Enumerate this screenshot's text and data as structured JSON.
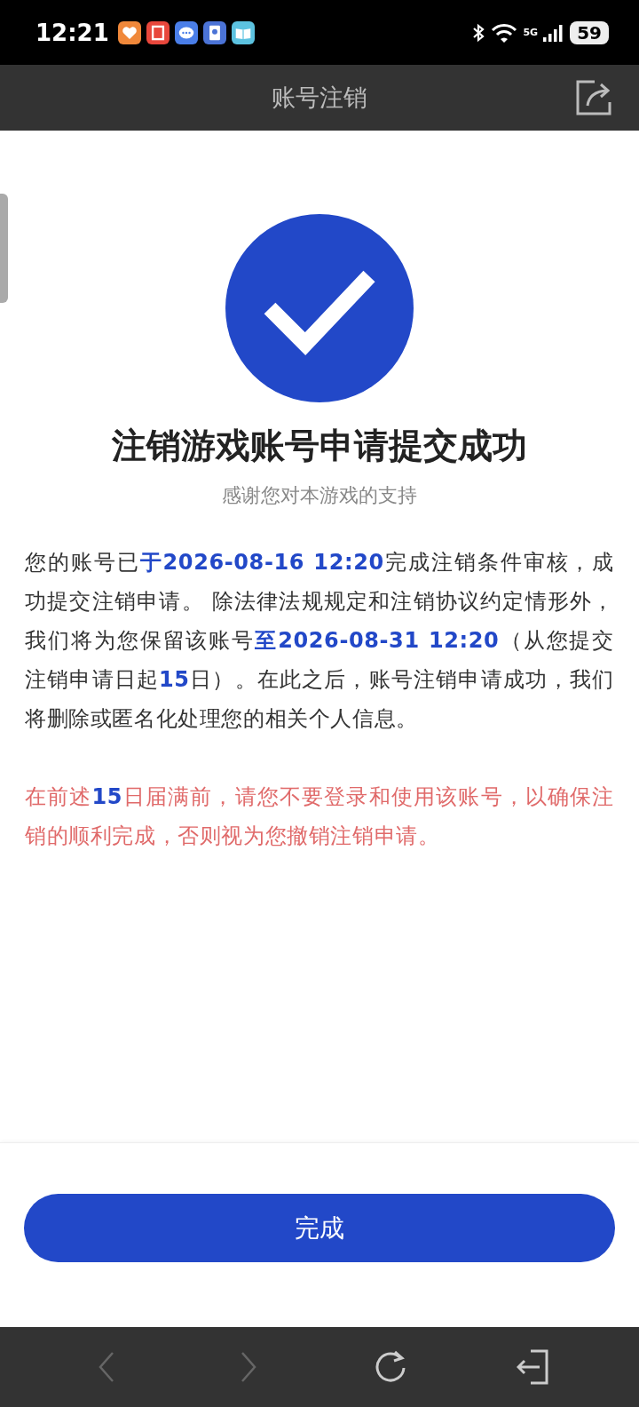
{
  "status_bar": {
    "time": "12:21",
    "network": "5G",
    "battery": "59"
  },
  "header": {
    "title": "账号注销"
  },
  "result": {
    "title": "注销游戏账号申请提交成功",
    "subtitle": "感谢您对本游戏的支持",
    "body": "您的账号已**于2026-08-16 12:20**完成注销条件审核，成功提交注销申请。 除法律法规规定和注销协议约定情形外，我们将为您保留该账号**至2026-08-31 12:20**（从您提交注销申请日起**15**日）。在此之后，账号注销申请成功，我们将删除或匿名化处理您的相关个人信息。",
    "warning": "在前述**15**日届满前，请您不要登录和使用该账号，以确保注销的顺利完成，否则视为您撤销注销申请。"
  },
  "primary_button": {
    "label": "完成"
  },
  "nav_bar": {
    "items": [
      {
        "kind": "back",
        "disabled": true
      },
      {
        "kind": "forward",
        "disabled": true
      },
      {
        "kind": "reload",
        "disabled": false
      },
      {
        "kind": "exit",
        "disabled": false
      }
    ]
  }
}
